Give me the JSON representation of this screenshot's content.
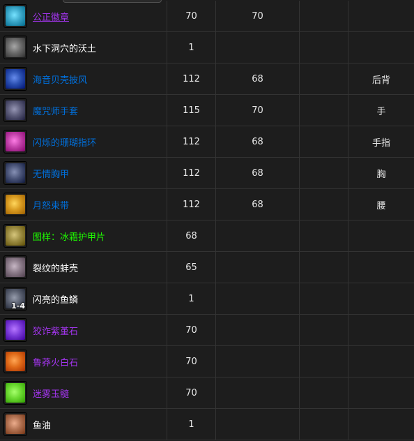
{
  "rows": [
    {
      "name": "公正徽章",
      "quality": "epic",
      "underline": true,
      "col1": "70",
      "col2": "70",
      "slot": "",
      "icon": "badge-of-justice-icon",
      "icon_color": "#3aa6c8",
      "stack": ""
    },
    {
      "name": "水下洞穴的沃土",
      "quality": "common",
      "underline": false,
      "col1": "1",
      "col2": "",
      "slot": "",
      "icon": "cave-soil-icon",
      "icon_color": "#6a6a6a",
      "stack": ""
    },
    {
      "name": "海音贝壳披风",
      "quality": "rare",
      "underline": false,
      "col1": "112",
      "col2": "68",
      "slot": "后背",
      "icon": "cloak-icon",
      "icon_color": "#2a4fb0",
      "stack": ""
    },
    {
      "name": "魔咒师手套",
      "quality": "rare",
      "underline": false,
      "col1": "115",
      "col2": "70",
      "slot": "手",
      "icon": "gloves-icon",
      "icon_color": "#5a5a78",
      "stack": ""
    },
    {
      "name": "闪烁的珊瑚指环",
      "quality": "rare",
      "underline": false,
      "col1": "112",
      "col2": "68",
      "slot": "手指",
      "icon": "ring-icon",
      "icon_color": "#c040a8",
      "stack": ""
    },
    {
      "name": "无情胸甲",
      "quality": "rare",
      "underline": false,
      "col1": "112",
      "col2": "68",
      "slot": "胸",
      "icon": "chest-armor-icon",
      "icon_color": "#4a5478",
      "stack": ""
    },
    {
      "name": "月怒束带",
      "quality": "rare",
      "underline": false,
      "col1": "112",
      "col2": "68",
      "slot": "腰",
      "icon": "belt-icon",
      "icon_color": "#d89a20",
      "stack": ""
    },
    {
      "name": "图样：冰霜护甲片",
      "quality": "uncommon",
      "underline": false,
      "col1": "68",
      "col2": "",
      "slot": "",
      "icon": "pattern-scroll-icon",
      "icon_color": "#9a8a40",
      "stack": ""
    },
    {
      "name": "裂纹的蚌壳",
      "quality": "common",
      "underline": false,
      "col1": "65",
      "col2": "",
      "slot": "",
      "icon": "clam-shell-icon",
      "icon_color": "#8a7a88",
      "stack": ""
    },
    {
      "name": "闪亮的鱼鳞",
      "quality": "common",
      "underline": false,
      "col1": "1",
      "col2": "",
      "slot": "",
      "icon": "fish-scale-icon",
      "icon_color": "#5a6070",
      "stack": "1-4"
    },
    {
      "name": "狡诈紫堇石",
      "quality": "epic",
      "underline": false,
      "col1": "70",
      "col2": "",
      "slot": "",
      "icon": "purple-gem-icon",
      "icon_color": "#7a3ad8",
      "stack": ""
    },
    {
      "name": "鲁莽火白石",
      "quality": "epic",
      "underline": false,
      "col1": "70",
      "col2": "",
      "slot": "",
      "icon": "orange-gem-icon",
      "icon_color": "#e06a18",
      "stack": ""
    },
    {
      "name": "迷雾玉髓",
      "quality": "epic",
      "underline": false,
      "col1": "70",
      "col2": "",
      "slot": "",
      "icon": "green-gem-icon",
      "icon_color": "#6ad830",
      "stack": ""
    },
    {
      "name": "鱼油",
      "quality": "common",
      "underline": false,
      "col1": "1",
      "col2": "",
      "slot": "",
      "icon": "fish-oil-vial-icon",
      "icon_color": "#b07050",
      "stack": ""
    }
  ]
}
